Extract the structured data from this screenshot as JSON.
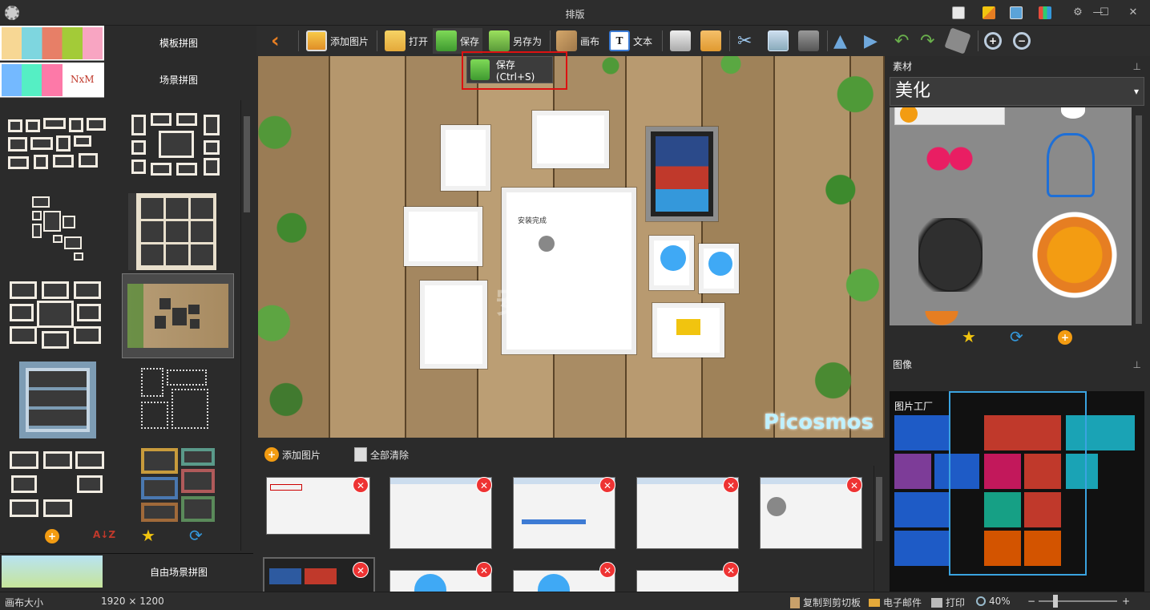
{
  "window": {
    "title": "排版",
    "controls": [
      "minimize",
      "maximize",
      "close"
    ]
  },
  "left": {
    "templates_label": "模板拼图",
    "scenes_label": "场景拼图",
    "free_label": "自由场景拼图",
    "nxm_text": "NxM"
  },
  "toolbar": {
    "add_image": "添加图片",
    "open": "打开",
    "save": "保存",
    "save_as": "另存为",
    "canvas": "画布",
    "text": "文本"
  },
  "tooltip": {
    "text": "保存 (Ctrl+S)"
  },
  "canvas": {
    "watermark": "Picosmos"
  },
  "image_bar": {
    "add_image": "添加图片",
    "clear_all": "全部清除"
  },
  "right": {
    "material_header": "素材",
    "material_combo": "美化",
    "image_header": "图像",
    "preview_title": "图片工厂"
  },
  "status": {
    "canvas_size_label": "画布大小",
    "canvas_size_value": "1920 × 1200",
    "copy_clipboard": "复制到剪切板",
    "email": "电子邮件",
    "print": "打印",
    "zoom": "40%"
  },
  "colors": {
    "accent_red": "#dd1111",
    "preview_highlight": "#3aa3e0",
    "orange": "#f39c12"
  }
}
